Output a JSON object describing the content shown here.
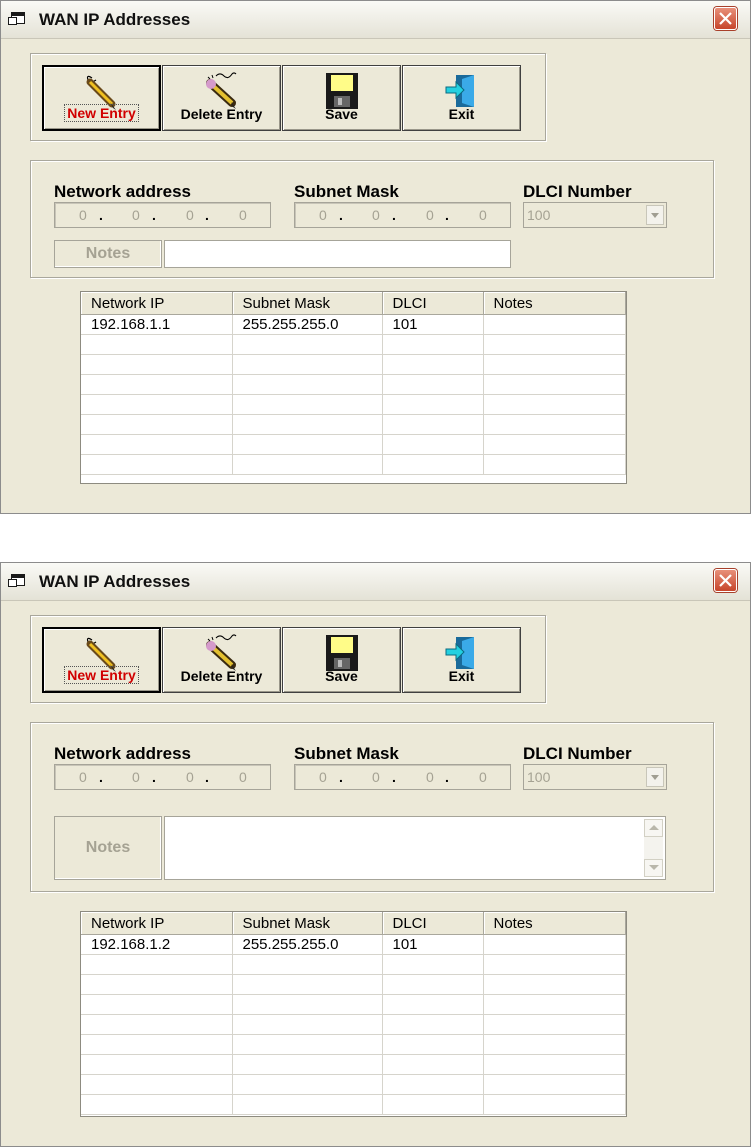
{
  "windows": [
    {
      "title": "WAN IP Addresses",
      "toolbar": {
        "new_entry": "New Entry",
        "delete_entry": "Delete Entry",
        "save": "Save",
        "exit": "Exit"
      },
      "form": {
        "network_address_label": "Network address",
        "subnet_mask_label": "Subnet Mask",
        "dlci_label": "DLCI Number",
        "network_address_octets": [
          "0",
          "0",
          "0",
          "0"
        ],
        "subnet_mask_octets": [
          "0",
          "0",
          "0",
          "0"
        ],
        "dlci_value": "100",
        "notes_label": "Notes",
        "notes_value": ""
      },
      "table": {
        "headers": [
          "Network IP",
          "Subnet Mask",
          "DLCI",
          "Notes"
        ],
        "rows": [
          [
            "192.168.1.1",
            "255.255.255.0",
            "101",
            ""
          ]
        ]
      }
    },
    {
      "title": "WAN IP Addresses",
      "toolbar": {
        "new_entry": "New Entry",
        "delete_entry": "Delete Entry",
        "save": "Save",
        "exit": "Exit"
      },
      "form": {
        "network_address_label": "Network address",
        "subnet_mask_label": "Subnet Mask",
        "dlci_label": "DLCI Number",
        "network_address_octets": [
          "0",
          "0",
          "0",
          "0"
        ],
        "subnet_mask_octets": [
          "0",
          "0",
          "0",
          "0"
        ],
        "dlci_value": "100",
        "notes_label": "Notes",
        "notes_value": ""
      },
      "table": {
        "headers": [
          "Network IP",
          "Subnet Mask",
          "DLCI",
          "Notes"
        ],
        "rows": [
          [
            "192.168.1.2",
            "255.255.255.0",
            "101",
            ""
          ]
        ]
      }
    }
  ]
}
